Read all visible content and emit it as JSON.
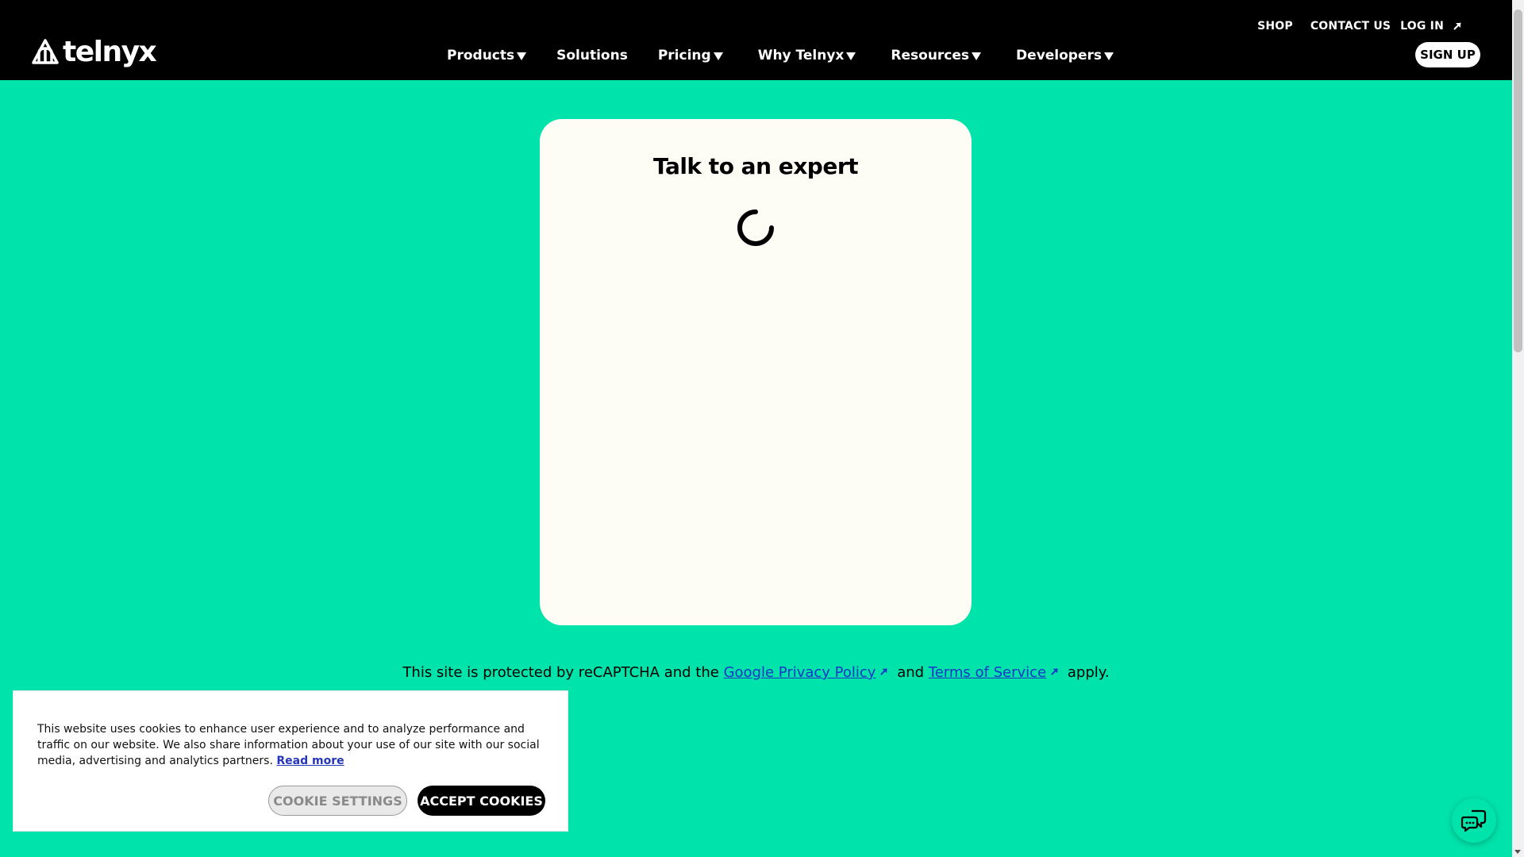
{
  "brand": {
    "name": "telnyx"
  },
  "utility_nav": {
    "shop": "SHOP",
    "contact_us": "CONTACT US",
    "log_in": "LOG IN"
  },
  "main_nav": [
    {
      "label": "Products",
      "has_dropdown": true
    },
    {
      "label": "Solutions",
      "has_dropdown": false
    },
    {
      "label": "Pricing",
      "has_dropdown": true
    },
    {
      "label": "Why Telnyx",
      "has_dropdown": true
    },
    {
      "label": "Resources",
      "has_dropdown": true
    },
    {
      "label": "Developers",
      "has_dropdown": true
    }
  ],
  "signup": "SIGN UP",
  "card": {
    "title": "Talk to an expert"
  },
  "recaptcha": {
    "prefix": "This site is protected by reCAPTCHA and the",
    "privacy_link": "Google Privacy Policy",
    "and": "and",
    "terms_link": "Terms of Service",
    "suffix": "apply."
  },
  "cookie_banner": {
    "text": "This website uses cookies to enhance user experience and to analyze performance and traffic on our website. We also share information about your use of our site with our social media, advertising and analytics partners.",
    "read_more": "Read more",
    "settings_button": "COOKIE SETTINGS",
    "accept_button": "ACCEPT COOKIES"
  },
  "icons": {
    "logo": "telnyx-logo-icon",
    "external": "arrow-up-right-icon",
    "caret": "caret-down-icon",
    "spinner": "loading-spinner-icon",
    "chat": "chat-bubbles-icon"
  },
  "colors": {
    "accent": "#00e3aa",
    "header_bg": "#000000",
    "card_bg": "#fefdf5",
    "link": "#1a35c8"
  }
}
